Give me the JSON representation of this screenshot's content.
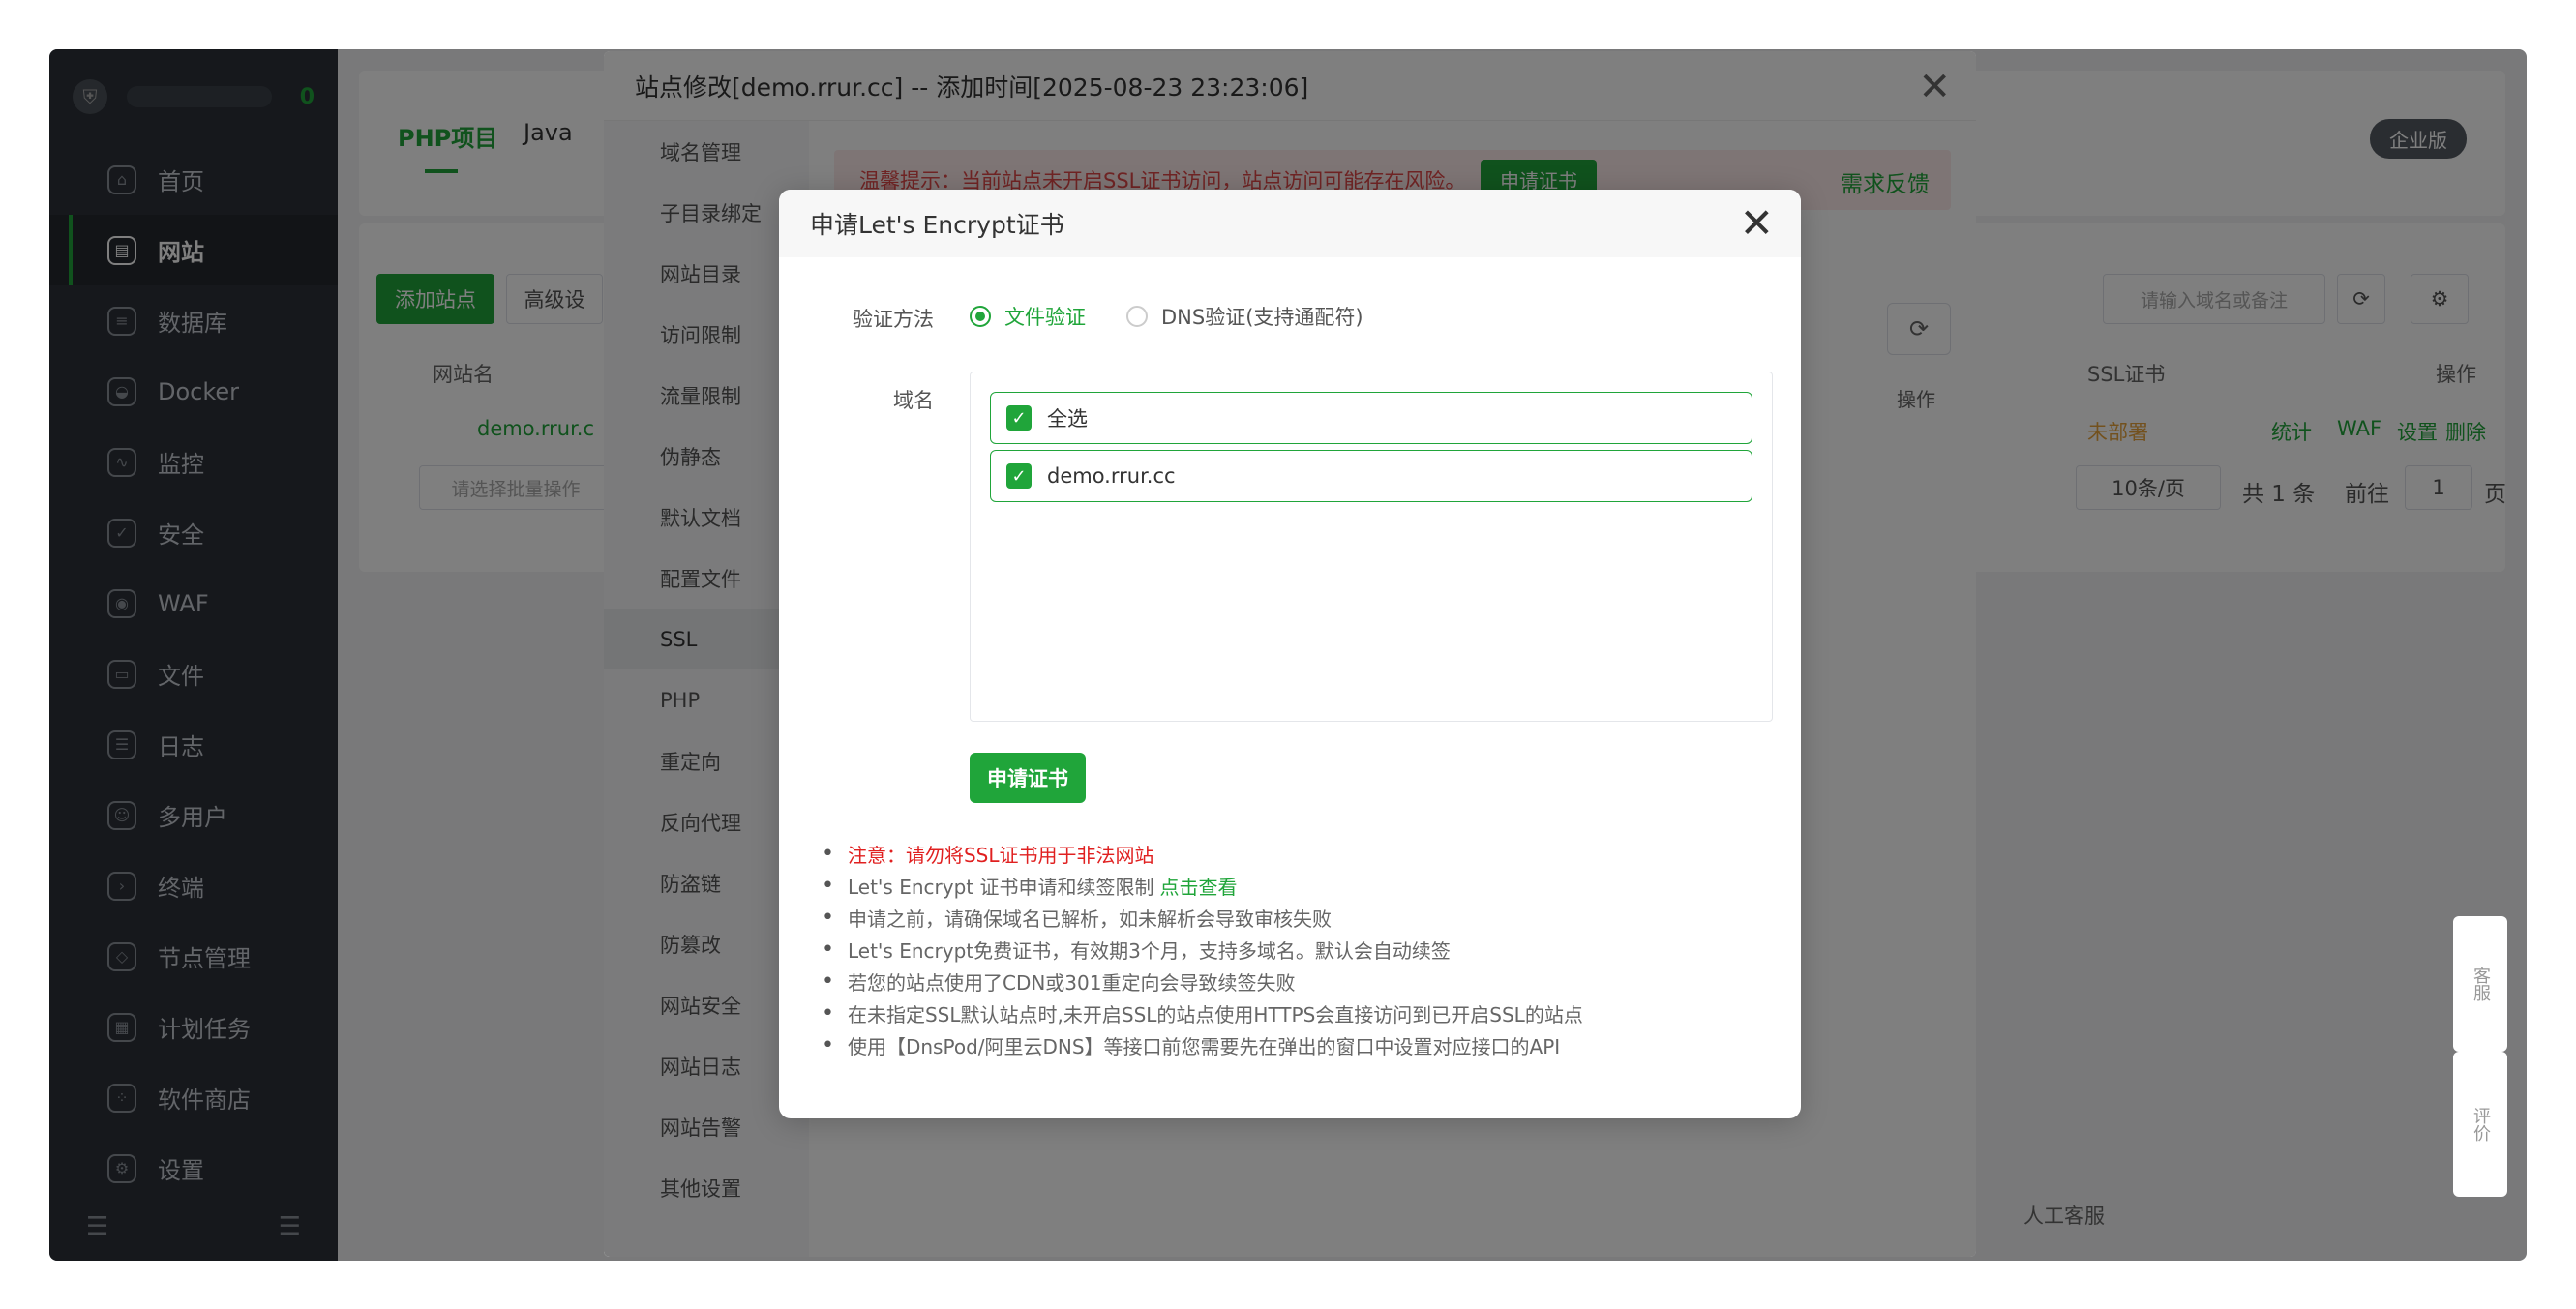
{
  "sidebar": {
    "badge": "0",
    "items": [
      {
        "label": "首页",
        "icon": "home-icon"
      },
      {
        "label": "网站",
        "icon": "globe-icon",
        "active": true
      },
      {
        "label": "数据库",
        "icon": "database-icon"
      },
      {
        "label": "Docker",
        "icon": "docker-icon"
      },
      {
        "label": "监控",
        "icon": "monitor-icon"
      },
      {
        "label": "安全",
        "icon": "shield-icon"
      },
      {
        "label": "WAF",
        "icon": "waf-icon"
      },
      {
        "label": "文件",
        "icon": "folder-icon"
      },
      {
        "label": "日志",
        "icon": "log-icon"
      },
      {
        "label": "多用户",
        "icon": "users-icon"
      },
      {
        "label": "终端",
        "icon": "terminal-icon"
      },
      {
        "label": "节点管理",
        "icon": "node-icon"
      },
      {
        "label": "计划任务",
        "icon": "calendar-icon"
      },
      {
        "label": "软件商店",
        "icon": "store-icon"
      },
      {
        "label": "设置",
        "icon": "gear-icon"
      }
    ]
  },
  "background": {
    "tab_php": "PHP项目",
    "tab_java": "Java",
    "enterprise": "企业版",
    "add_site": "添加站点",
    "advanced": "高级设",
    "col_site": "网站名",
    "row_site": "demo.rrur.c",
    "batch_placeholder": "请选择批量操作",
    "search_placeholder": "请输入域名或备注",
    "col_ssl": "SSL证书",
    "col_ops": "操作",
    "ssl_status": "未部署",
    "op_stats": "统计",
    "op_waf": "WAF",
    "op_settings": "设置",
    "op_delete": "删除",
    "page_size": "10条/页",
    "total": "共 1 条",
    "goto": "前往",
    "page_num": "1",
    "page_unit": "页",
    "support": "人工客服",
    "service": "客服",
    "review": "评价"
  },
  "site_dialog": {
    "title": "站点修改[demo.rrur.cc] -- 添加时间[2025-08-23 23:23:06]",
    "menu": [
      "域名管理",
      "子目录绑定",
      "网站目录",
      "访问限制",
      "流量限制",
      "伪静态",
      "默认文档",
      "配置文件",
      "SSL",
      "PHP",
      "重定向",
      "反向代理",
      "防盗链",
      "防篡改",
      "网站安全",
      "网站日志",
      "网站告警",
      "其他设置"
    ],
    "warning": "温馨提示：当前站点未开启SSL证书访问，站点访问可能存在风险。",
    "warning_button": "申请证书",
    "feedback": "需求反馈",
    "ops": "操作"
  },
  "le_dialog": {
    "title": "申请Let's Encrypt证书",
    "verify_label": "验证方法",
    "verify_file": "文件验证",
    "verify_dns": "DNS验证(支持通配符)",
    "domain_label": "域名",
    "select_all": "全选",
    "domain": "demo.rrur.cc",
    "apply_button": "申请证书",
    "notes": [
      "注意：请勿将SSL证书用于非法网站",
      "Let's Encrypt 证书申请和续签限制",
      "申请之前，请确保域名已解析，如未解析会导致审核失败",
      "Let's Encrypt免费证书，有效期3个月，支持多域名。默认会自动续签",
      "若您的站点使用了CDN或301重定向会导致续签失败",
      "在未指定SSL默认站点时,未开启SSL的站点使用HTTPS会直接访问到已开启SSL的站点",
      "使用【DnsPod/阿里云DNS】等接口前您需要先在弹出的窗口中设置对应接口的API"
    ],
    "note_link": "点击查看"
  }
}
